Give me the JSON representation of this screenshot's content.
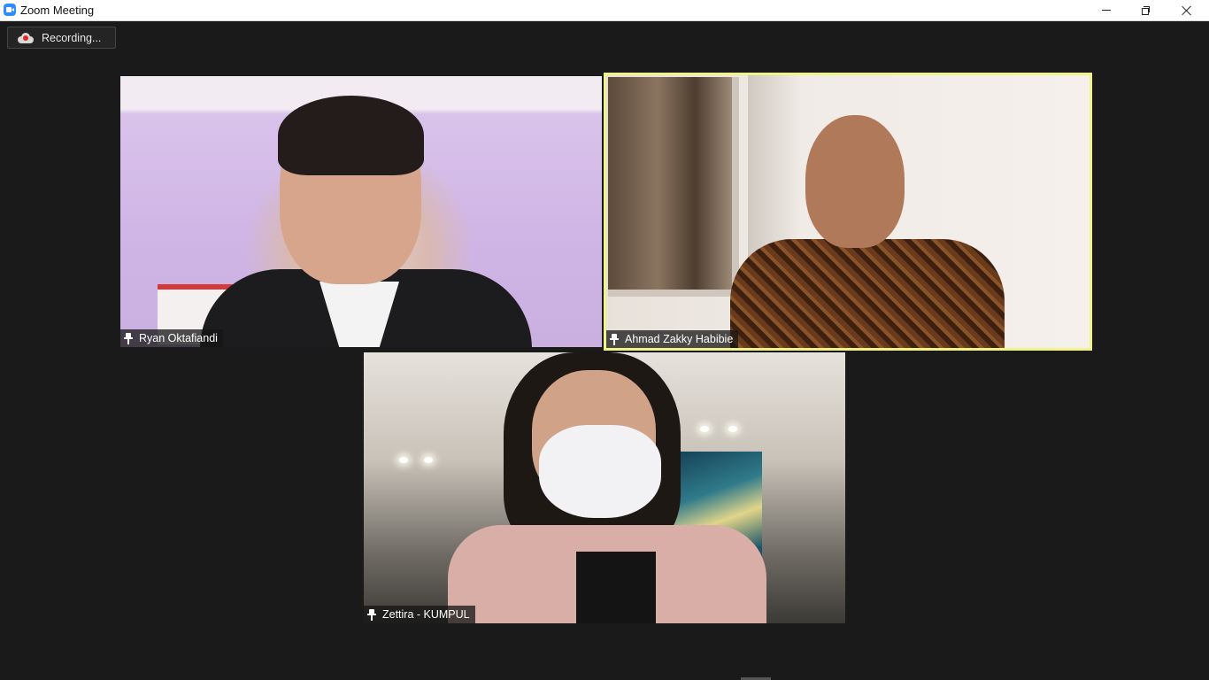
{
  "window": {
    "title": "Zoom Meeting",
    "accent": "#2d8cff"
  },
  "recording": {
    "label": "Recording...",
    "indicator_color": "#e02828"
  },
  "participants": [
    {
      "name": "Ryan Oktafiandi",
      "icon": "pin-icon",
      "active_speaker": false
    },
    {
      "name": "Ahmad Zakky Habibie",
      "icon": "pin-icon",
      "active_speaker": true,
      "highlight_color": "#f0f38c"
    },
    {
      "name": "Zettira - KUMPUL",
      "icon": "pin-icon",
      "active_speaker": false
    }
  ]
}
